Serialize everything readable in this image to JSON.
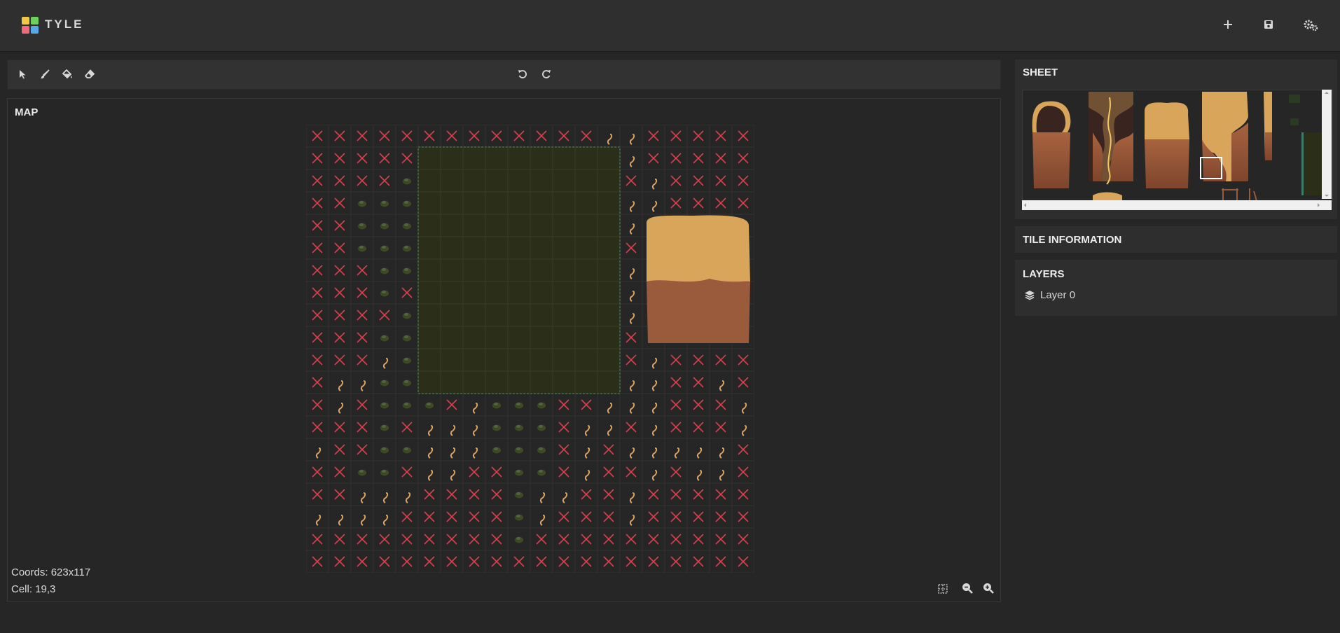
{
  "app": {
    "title": "TYLE"
  },
  "topbar": {
    "buttons": [
      {
        "name": "new",
        "icon": "plus-icon"
      },
      {
        "name": "save",
        "icon": "save-icon"
      },
      {
        "name": "settings",
        "icon": "gears-icon"
      }
    ]
  },
  "toolbar": {
    "tools": [
      {
        "name": "select",
        "icon": "cursor-icon"
      },
      {
        "name": "brush",
        "icon": "brush-icon"
      },
      {
        "name": "fill",
        "icon": "fill-bucket-icon"
      },
      {
        "name": "erase",
        "icon": "eraser-icon"
      }
    ],
    "history": [
      {
        "name": "undo",
        "icon": "undo-icon"
      },
      {
        "name": "redo",
        "icon": "redo-icon"
      }
    ]
  },
  "map": {
    "title": "MAP",
    "coords": "Coords: 623x117",
    "cell": "Cell: 19,3",
    "grid": {
      "columns": 20,
      "rows": 20,
      "selected_cell": "19,3"
    },
    "controls": [
      {
        "name": "grid",
        "icon": "grid-icon"
      },
      {
        "name": "zoom-out",
        "icon": "zoom-out-icon"
      },
      {
        "name": "zoom-in",
        "icon": "zoom-in-icon"
      }
    ]
  },
  "sheet": {
    "title": "SHEET"
  },
  "tile_info": {
    "title": "TILE INFORMATION"
  },
  "layers": {
    "title": "LAYERS",
    "items": [
      {
        "label": "Layer 0",
        "icon": "layers-icon"
      }
    ]
  },
  "colors": {
    "background": "#262626",
    "panel": "#2e2e2e",
    "empty_cell_mark": "#d9414b",
    "grass_edge": "#3e7a6a",
    "dark_grass": "#2b2e18",
    "sand": "#d9a55a",
    "dirt": "#9a5a3c"
  }
}
